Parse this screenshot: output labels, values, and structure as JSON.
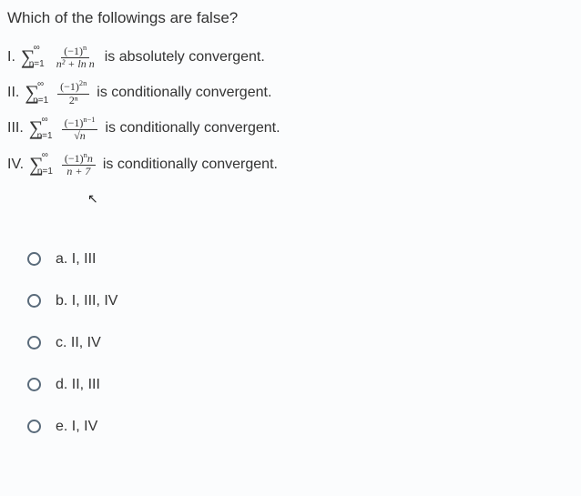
{
  "question": "Which of the followings are false?",
  "statements": [
    {
      "roman": "I.",
      "sup": "∞",
      "sub": "n=1",
      "num": "(−1)",
      "num_exp": "n",
      "den": "n² + ln n",
      "desc": "is absolutely convergent."
    },
    {
      "roman": "II.",
      "sup": "∞",
      "sub": "n=1",
      "num": "(−1)",
      "num_exp": "2n",
      "den": "2ⁿ",
      "desc": "is conditionally convergent."
    },
    {
      "roman": "III.",
      "sup": "∞",
      "sub": "n=1",
      "num": "(−1)",
      "num_exp": "n−1",
      "den": "√n",
      "desc": "is conditionally convergent."
    },
    {
      "roman": "IV.",
      "sup": "∞",
      "sub": "n=1",
      "num": "(−1)",
      "num_exp": "n",
      "num_tail": "n",
      "den": "n + 7",
      "desc": "is conditionally convergent."
    }
  ],
  "options": [
    {
      "label": "a. I, III"
    },
    {
      "label": "b. I, III, IV"
    },
    {
      "label": "c. II, IV"
    },
    {
      "label": "d. II, III"
    },
    {
      "label": "e. I, IV"
    }
  ]
}
